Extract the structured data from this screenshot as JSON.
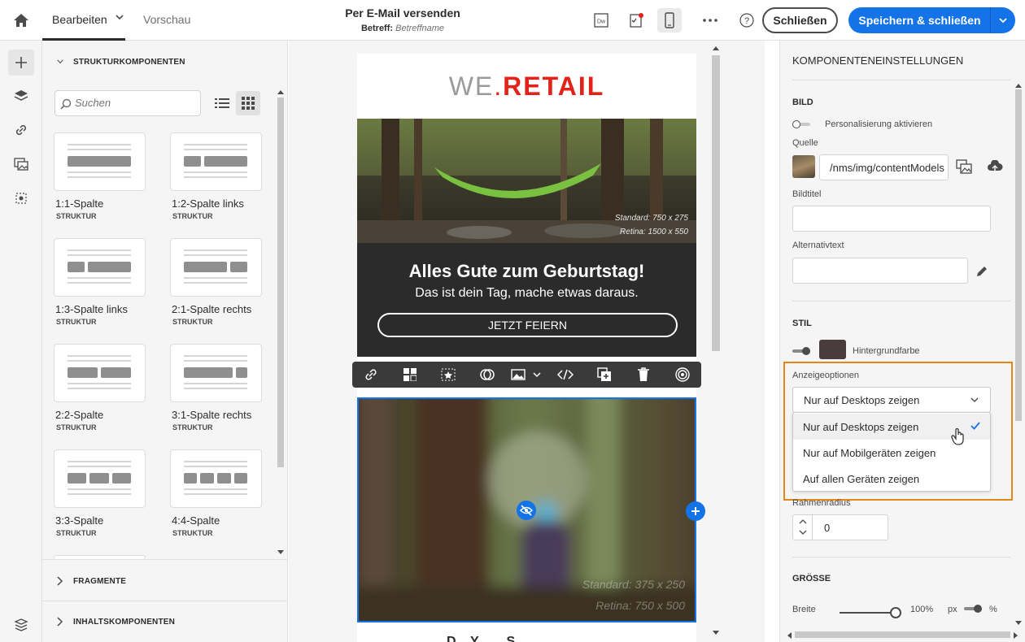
{
  "header": {
    "tab_edit": "Bearbeiten",
    "tab_preview": "Vorschau",
    "title": "Per E-Mail versenden",
    "subject_label": "Betreff:",
    "subject_value": "Betreffname",
    "dw_label": "Dw",
    "close_label": "Schließen",
    "save_label": "Speichern & schließen"
  },
  "left_panel": {
    "structure_title": "STRUKTURKOMPONENTEN",
    "search_placeholder": "Suchen",
    "cards": [
      {
        "name": "1:1-Spalte",
        "sub": "STRUKTUR"
      },
      {
        "name": "1:2-Spalte links",
        "sub": "STRUKTUR"
      },
      {
        "name": "1:3-Spalte links",
        "sub": "STRUKTUR"
      },
      {
        "name": "2:1-Spalte rechts",
        "sub": "STRUKTUR"
      },
      {
        "name": "2:2-Spalte",
        "sub": "STRUKTUR"
      },
      {
        "name": "3:1-Spalte rechts",
        "sub": "STRUKTUR"
      },
      {
        "name": "3:3-Spalte",
        "sub": "STRUKTUR"
      },
      {
        "name": "4:4-Spalte",
        "sub": "STRUKTUR"
      }
    ],
    "fragments_title": "FRAGMENTE",
    "content_title": "INHALTSKOMPONENTEN"
  },
  "email": {
    "logo_we": "WE",
    "logo_dot": ".",
    "logo_retail": "RETAIL",
    "hero_note1": "Standard: 750 x 275",
    "hero_note2": "Retina: 1500 x 550",
    "headline": "Alles Gute zum Geburtstag!",
    "subline": "Das ist dein Tag, mache etwas daraus.",
    "cta": "JETZT FEIERN",
    "sel_note1": "Standard: 375 x 250",
    "sel_note2": "Retina: 750 x 500",
    "bottom_text": "D... Y... ... S..."
  },
  "right_panel": {
    "title": "KOMPONENTENEINSTELLUNGEN",
    "bild": "BILD",
    "personalize": "Personalisierung aktivieren",
    "quelle": "Quelle",
    "source_value": "/nms/img/contentModels",
    "bildtitel": "Bildtitel",
    "alttext": "Alternativtext",
    "stil": "STIL",
    "bgcolor": "Hintergrundfarbe",
    "bgcolor_hex": "#4a3c3c",
    "anzeige": "Anzeigeoptionen",
    "dropdown_value": "Nur auf Desktops zeigen",
    "options": [
      "Nur auf Desktops zeigen",
      "Nur auf Mobilgeräten zeigen",
      "Auf allen Geräten zeigen"
    ],
    "rahmen": "Rahmenradius",
    "rahmen_value": "0",
    "groesse": "GRÖSSE",
    "breite": "Breite",
    "breite_value": "100%",
    "unit_px": "px",
    "unit_pct": "%"
  },
  "colors": {
    "accent": "#1473e6",
    "highlight": "#e68619",
    "brand_red": "#e2231a"
  }
}
